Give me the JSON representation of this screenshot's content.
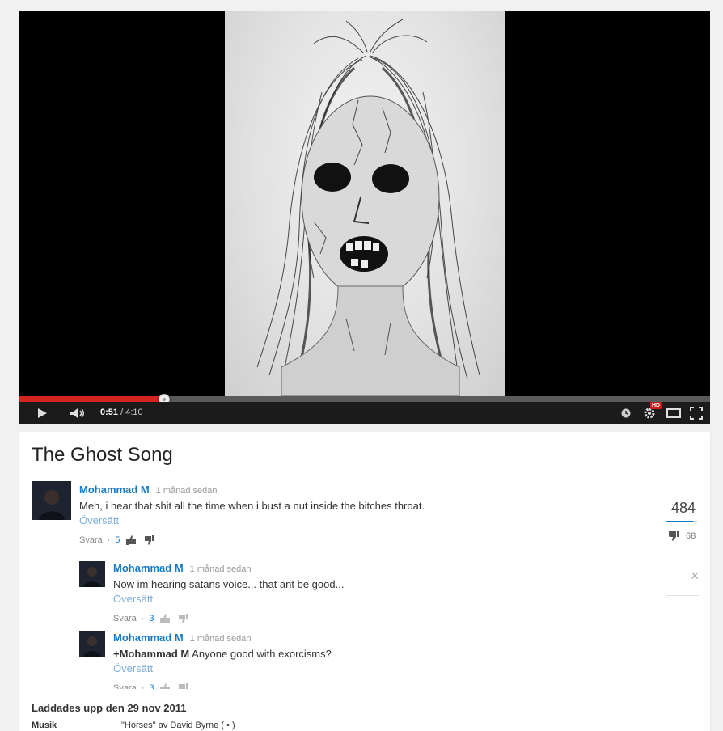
{
  "player": {
    "time_current": "0:51",
    "time_separator": " / ",
    "time_total": "4:10",
    "progress_fraction": 0.21,
    "buffer_fraction": 0.21,
    "hd_badge": "HD",
    "colors": {
      "played": "#d32420",
      "background": "#000000"
    },
    "icons": [
      "play-icon",
      "volume-icon",
      "watch-later-icon",
      "settings-icon",
      "theater-mode-icon",
      "fullscreen-icon"
    ]
  },
  "video": {
    "title": "The Ghost Song",
    "likes": "484",
    "dislikes": "68",
    "like_ratio": 0.88
  },
  "comments": [
    {
      "author": "Mohammad M",
      "time": "1 månad sedan",
      "text": "Meh, i hear that shit all the time when i bust a nut inside the bitches throat.",
      "translate": "Översätt",
      "reply": "Svara",
      "likes": "5"
    },
    {
      "author": "Mohammad M",
      "time": "1 månad sedan",
      "text": "Now im hearing satans voice... that ant be good...",
      "translate": "Översätt",
      "reply": "Svara",
      "likes": "3"
    },
    {
      "author": "Mohammad M",
      "time": "1 månad sedan",
      "mention": "+Mohammad M",
      "text": " Anyone good with exorcisms?",
      "translate": "Översätt",
      "reply": "Svara",
      "likes": "3"
    }
  ],
  "actions_separator": "·",
  "meta": {
    "uploaded": "Laddades upp den 29 nov 2011",
    "music_label": "Musik",
    "music_value": "\"Horses\" av David Byrne ( • )"
  },
  "panel": {
    "close": "×"
  }
}
